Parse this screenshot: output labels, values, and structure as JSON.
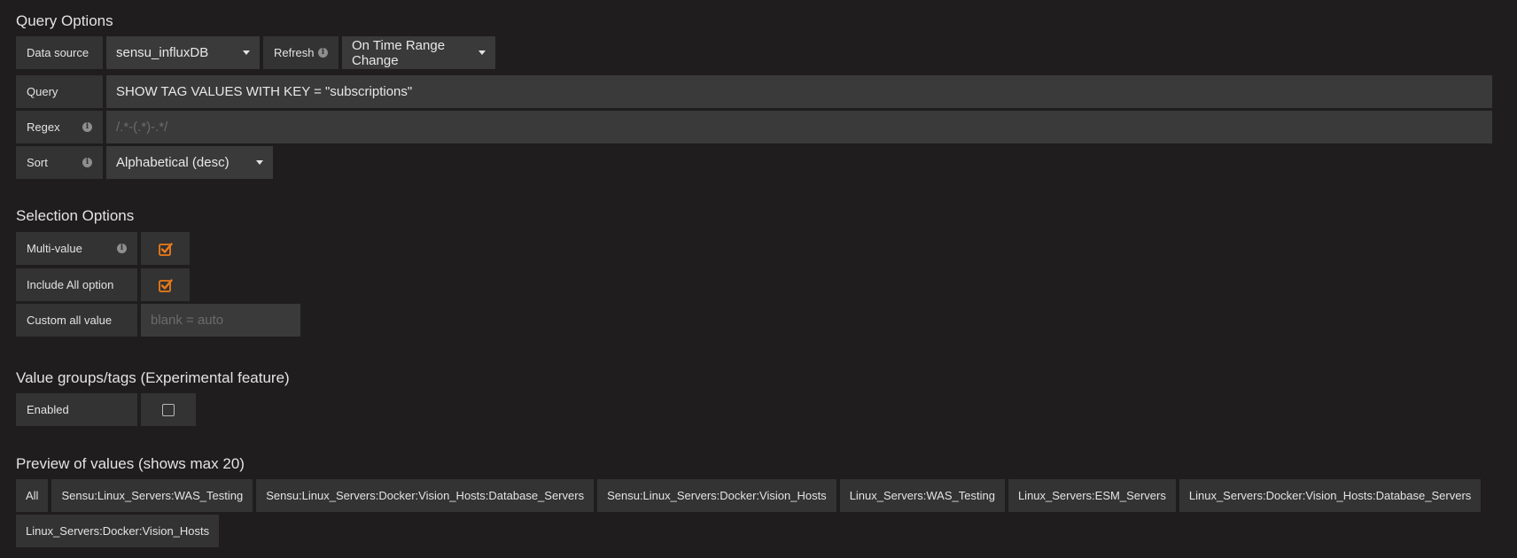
{
  "query_options": {
    "title": "Query Options",
    "data_source": {
      "label": "Data source",
      "value": "sensu_influxDB"
    },
    "refresh": {
      "label": "Refresh",
      "value": "On Time Range Change"
    },
    "query": {
      "label": "Query",
      "value": "SHOW TAG VALUES WITH KEY = \"subscriptions\""
    },
    "regex": {
      "label": "Regex",
      "placeholder": "/.*-(.*)-.*/"
    },
    "sort": {
      "label": "Sort",
      "value": "Alphabetical (desc)"
    }
  },
  "selection_options": {
    "title": "Selection Options",
    "multi_value": {
      "label": "Multi-value",
      "checked": true
    },
    "include_all": {
      "label": "Include All option",
      "checked": true
    },
    "custom_all": {
      "label": "Custom all value",
      "placeholder": "blank = auto"
    }
  },
  "value_groups": {
    "title": "Value groups/tags (Experimental feature)",
    "enabled": {
      "label": "Enabled",
      "checked": false
    }
  },
  "preview": {
    "title": "Preview of values (shows max 20)",
    "values": [
      "All",
      "Sensu:Linux_Servers:WAS_Testing",
      "Sensu:Linux_Servers:Docker:Vision_Hosts:Database_Servers",
      "Sensu:Linux_Servers:Docker:Vision_Hosts",
      "Linux_Servers:WAS_Testing",
      "Linux_Servers:ESM_Servers",
      "Linux_Servers:Docker:Vision_Hosts:Database_Servers",
      "Linux_Servers:Docker:Vision_Hosts"
    ]
  },
  "colors": {
    "background": "#1f1d1e",
    "label_bg": "#333334",
    "field_bg": "#3a3a3b",
    "accent": "#eb7b18"
  },
  "icons": {
    "info": "info-icon",
    "caret": "caret-down-icon",
    "checked": "checkbox-checked-icon",
    "unchecked": "checkbox-unchecked-icon"
  }
}
